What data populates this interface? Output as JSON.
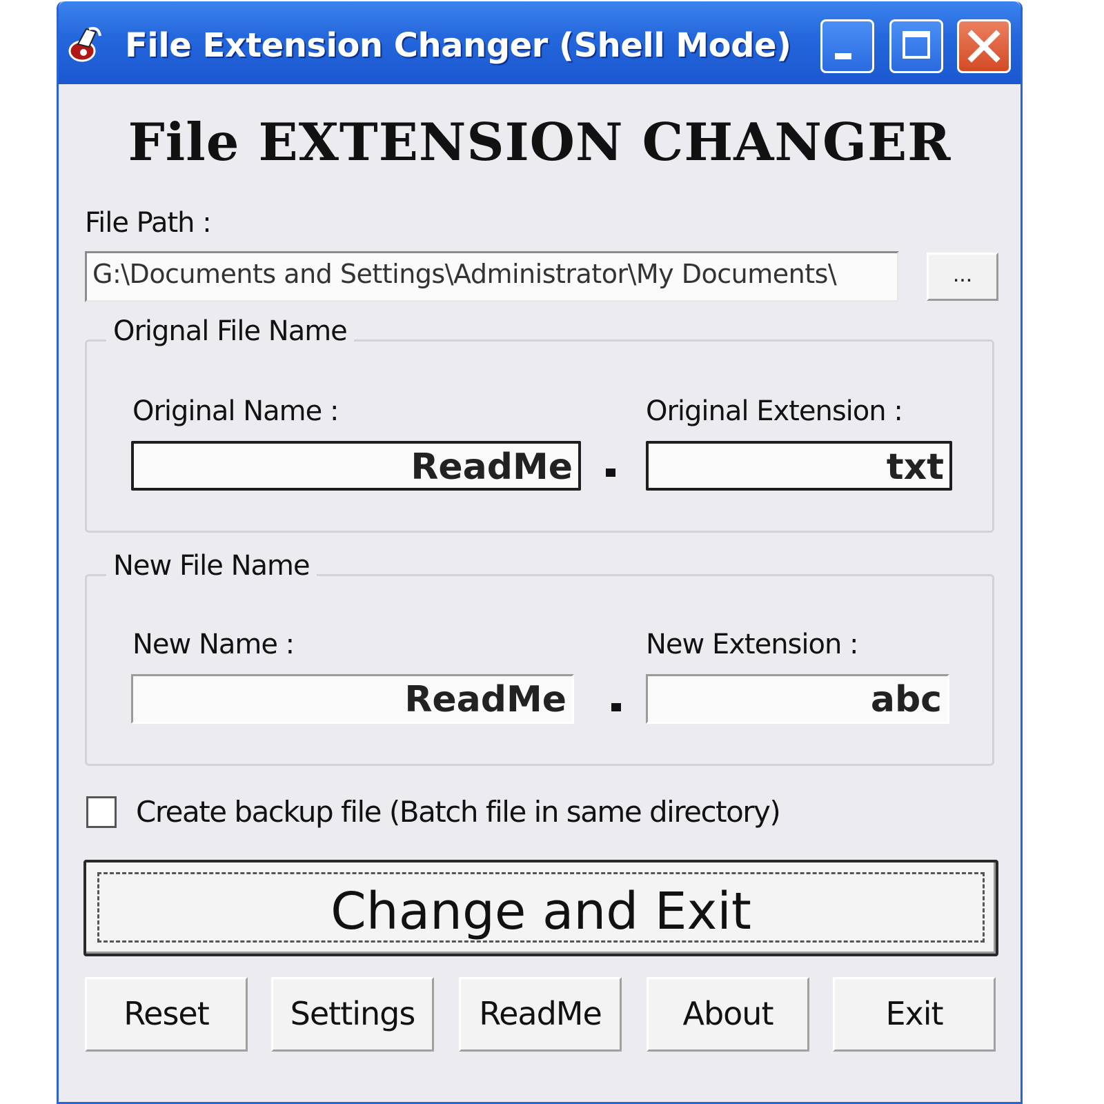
{
  "window": {
    "title": "File Extension Changer (Shell Mode)"
  },
  "header": {
    "title": "File EXTENSION CHANGER"
  },
  "file_path": {
    "label": "File Path :",
    "value": "G:\\Documents and Settings\\Administrator\\My Documents\\",
    "browse_label": "..."
  },
  "original_group": {
    "legend": "Orignal File Name",
    "name_label": "Original Name :",
    "name_value": "ReadMe",
    "ext_label": "Original Extension :",
    "ext_value": "txt"
  },
  "new_group": {
    "legend": "New File Name",
    "name_label": "New Name :",
    "name_value": "ReadMe",
    "ext_label": "New Extension :",
    "ext_value": "abc"
  },
  "backup": {
    "label": "Create backup file (Batch file in same directory)",
    "checked": false
  },
  "actions": {
    "primary": "Change and Exit",
    "reset": "Reset",
    "settings": "Settings",
    "readme": "ReadMe",
    "about": "About",
    "exit": "Exit"
  },
  "icons": {
    "app": "app-icon",
    "minimize": "minimize-icon",
    "maximize": "maximize-icon",
    "close": "close-icon"
  },
  "colors": {
    "titlebar": "#2466db",
    "close_button": "#d34a24",
    "window_bg": "#ecebf0"
  }
}
